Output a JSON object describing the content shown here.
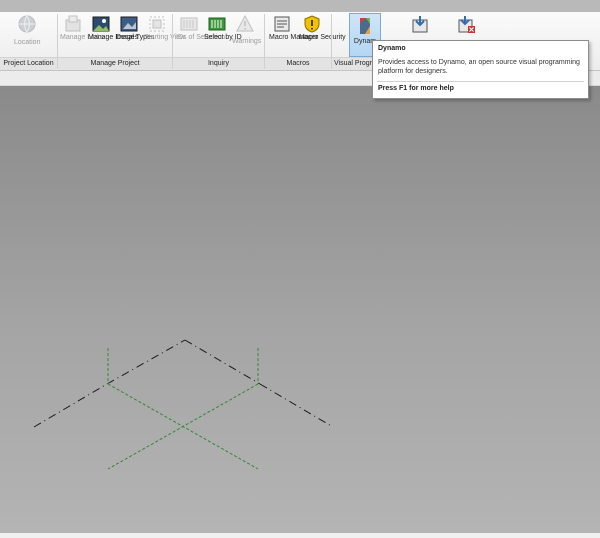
{
  "ribbon": {
    "panels": [
      {
        "label": "Project Location",
        "buttons": [
          {
            "label": "Location",
            "icon": "globe-icon",
            "enabled": false
          }
        ]
      },
      {
        "label": "Manage Project",
        "buttons": [
          {
            "label": "Manage Links",
            "icon": "manage-links-icon",
            "enabled": false
          },
          {
            "label": "Manage Images",
            "icon": "manage-images-icon",
            "enabled": true
          },
          {
            "label": "Decal Types",
            "icon": "decal-types-icon",
            "enabled": true
          },
          {
            "label": "Starting View",
            "icon": "starting-view-icon",
            "enabled": false
          }
        ]
      },
      {
        "label": "Inquiry",
        "buttons": [
          {
            "label": "IDs of Selection",
            "icon": "ids-of-selection-icon",
            "enabled": false
          },
          {
            "label": "Select by ID",
            "icon": "select-by-id-icon",
            "enabled": true
          },
          {
            "label": "Warnings",
            "icon": "warnings-icon",
            "enabled": false
          }
        ]
      },
      {
        "label": "Macros",
        "buttons": [
          {
            "label": "Macro Manager",
            "icon": "macro-manager-icon",
            "enabled": true
          },
          {
            "label": "Macro Security",
            "icon": "macro-security-icon",
            "enabled": true
          }
        ]
      },
      {
        "label": "Visual Progra",
        "buttons": [
          {
            "label": "Dynam",
            "icon": "dynamo-icon",
            "enabled": true,
            "active": true
          }
        ]
      },
      {
        "label": "",
        "buttons": [
          {
            "label": "",
            "icon": "load-addin-icon",
            "enabled": true
          },
          {
            "label": "",
            "icon": "remove-addin-icon",
            "enabled": true
          }
        ]
      }
    ]
  },
  "tooltip": {
    "title": "Dynamo",
    "description": "Provides access to Dynamo, an open source visual programming platform for designers.",
    "help": "Press F1 for more help"
  },
  "colors": {
    "dash_dot_line": "#1a1a1a",
    "hidden_line": "#2e8b2e",
    "active_button": "#b4d6f3"
  }
}
